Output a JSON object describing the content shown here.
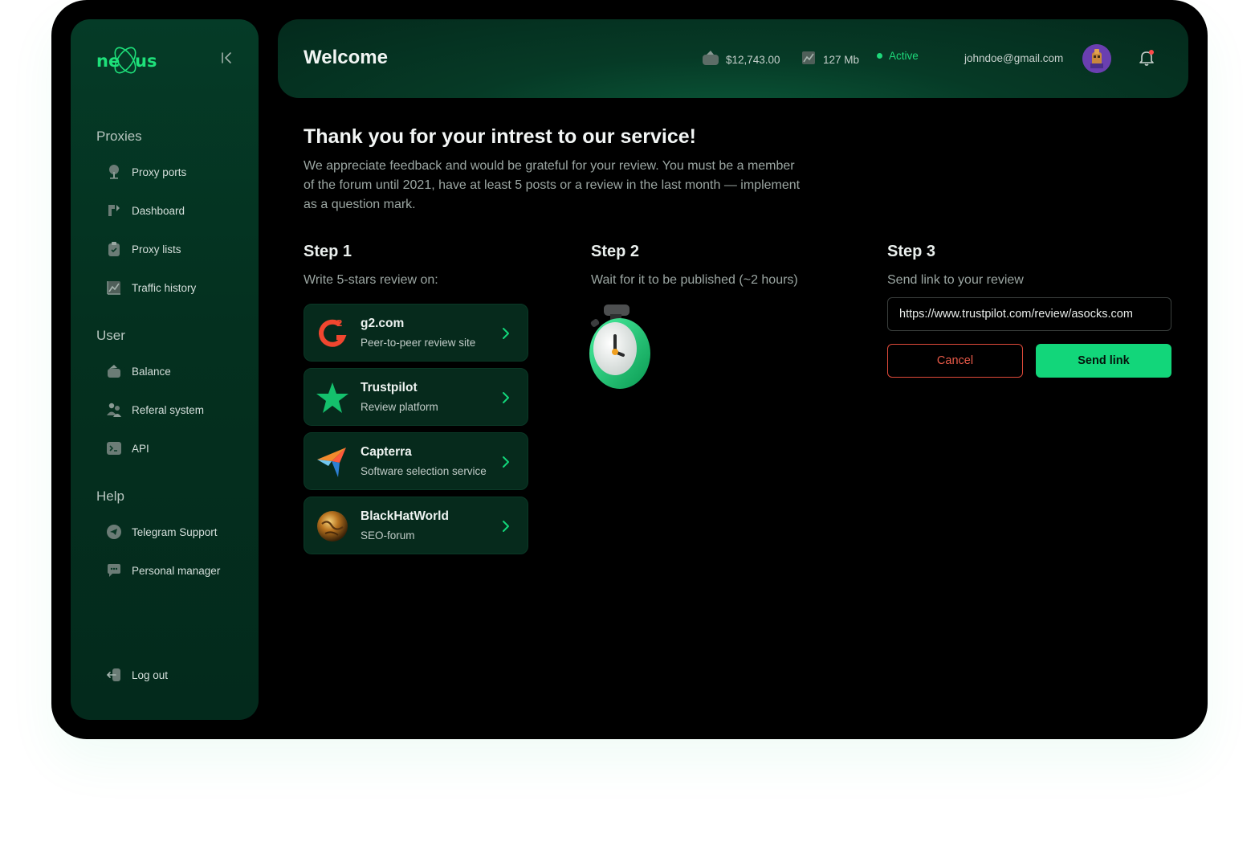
{
  "brand": {
    "logo_text": "nexus",
    "accent_color": "#12d67a"
  },
  "sidebar": {
    "sections": [
      {
        "title": "Proxies",
        "items": [
          {
            "label": "Proxy ports",
            "icon": "tree-icon"
          },
          {
            "label": "Dashboard",
            "icon": "dashboard-icon"
          },
          {
            "label": "Proxy lists",
            "icon": "clipboard-icon"
          },
          {
            "label": "Traffic history",
            "icon": "chart-icon"
          }
        ]
      },
      {
        "title": "User",
        "items": [
          {
            "label": "Balance",
            "icon": "wallet-icon"
          },
          {
            "label": "Referal system",
            "icon": "users-icon"
          },
          {
            "label": "API",
            "icon": "terminal-icon"
          }
        ]
      },
      {
        "title": "Help",
        "items": [
          {
            "label": "Telegram Support",
            "icon": "telegram-icon"
          },
          {
            "label": "Personal manager",
            "icon": "chat-icon"
          }
        ]
      }
    ],
    "logout_label": "Log out"
  },
  "topbar": {
    "title": "Welcome",
    "balance": "$12,743.00",
    "traffic": "127 Mb",
    "status": "Active",
    "email": "johndoe@gmail.com"
  },
  "main": {
    "title": "Thank you for your intrest to our service!",
    "description": "We appreciate feedback and would be grateful for your review. You must be a member of the forum until 2021, have at least 5 posts or a review in the last month — implement as a question mark.",
    "steps": [
      {
        "title": "Step 1",
        "subtitle": "Write 5-stars review on:"
      },
      {
        "title": "Step 2",
        "subtitle": "Wait for it to be published (~2 hours)"
      },
      {
        "title": "Step 3",
        "subtitle": "Send link to your review"
      }
    ],
    "sites": [
      {
        "name": "g2.com",
        "desc": "Peer-to-peer review site",
        "icon": "g2-logo-icon"
      },
      {
        "name": "Trustpilot",
        "desc": "Review platform",
        "icon": "trustpilot-star-icon"
      },
      {
        "name": "Capterra",
        "desc": "Software selection service",
        "icon": "capterra-arrow-icon"
      },
      {
        "name": "BlackHatWorld",
        "desc": "SEO-forum",
        "icon": "blackhatworld-globe-icon"
      }
    ],
    "link_value": "https://www.trustpilot.com/review/asocks.com",
    "cancel_label": "Cancel",
    "send_label": "Send link"
  }
}
